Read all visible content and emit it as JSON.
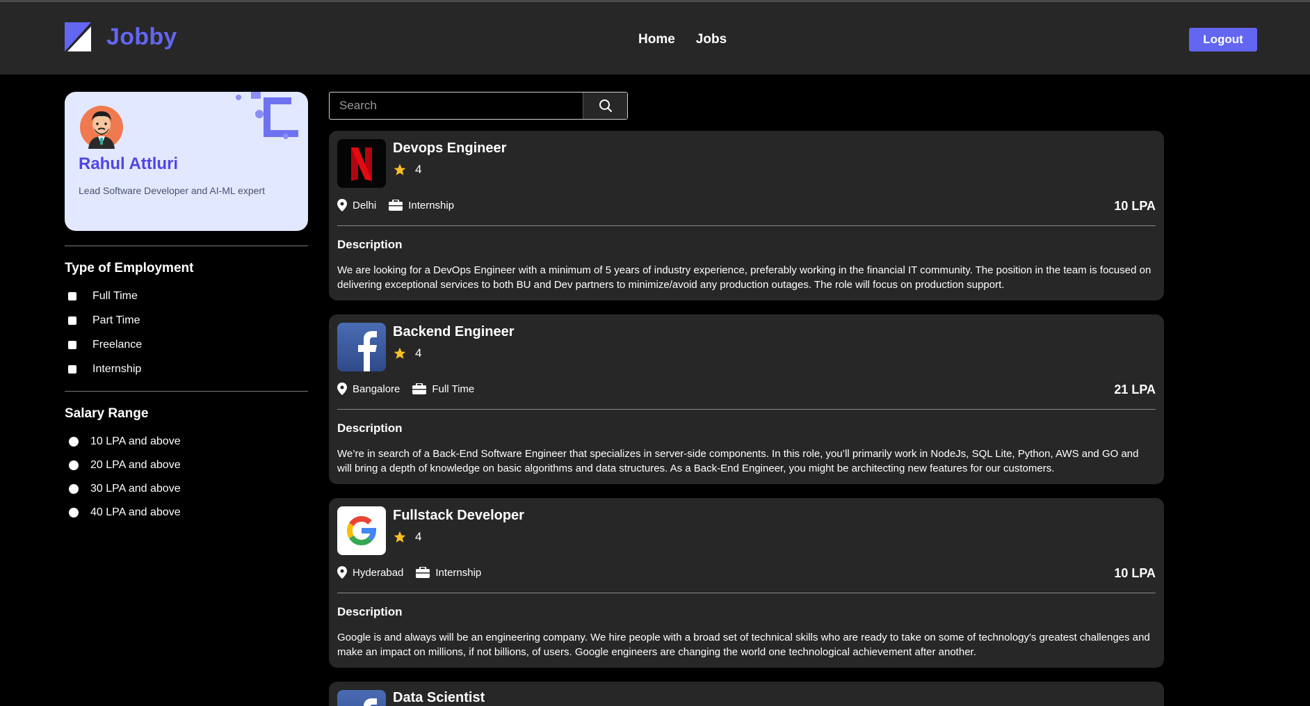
{
  "brand": {
    "name": "Jobby",
    "accent": "#6366f1"
  },
  "nav": {
    "home": "Home",
    "jobs": "Jobs",
    "logout": "Logout"
  },
  "profile": {
    "name": "Rahul Attluri",
    "bio": "Lead Software Developer and AI-ML expert"
  },
  "filters": {
    "employment_heading": "Type of Employment",
    "employment": [
      "Full Time",
      "Part Time",
      "Freelance",
      "Internship"
    ],
    "salary_heading": "Salary Range",
    "salary": [
      "10 LPA and above",
      "20 LPA and above",
      "30 LPA and above",
      "40 LPA and above"
    ]
  },
  "search": {
    "placeholder": "Search"
  },
  "jobs": [
    {
      "title": "Devops Engineer",
      "rating": "4",
      "location": "Delhi",
      "type": "Internship",
      "package": "10 LPA",
      "description_heading": "Description",
      "description": "We are looking for a DevOps Engineer with a minimum of 5 years of industry experience, preferably working in the financial IT community. The position in the team is focused on delivering exceptional services to both BU and Dev partners to minimize/avoid any production outages. The role will focus on production support.",
      "company_icon": "netflix-logo"
    },
    {
      "title": "Backend Engineer",
      "rating": "4",
      "location": "Bangalore",
      "type": "Full Time",
      "package": "21 LPA",
      "description_heading": "Description",
      "description": "We’re in search of a Back-End Software Engineer that specializes in server-side components. In this role, you’ll primarily work in NodeJs, SQL Lite, Python, AWS and GO and will bring a depth of knowledge on basic algorithms and data structures. As a Back-End Engineer, you might be architecting new features for our customers.",
      "company_icon": "facebook-logo"
    },
    {
      "title": "Fullstack Developer",
      "rating": "4",
      "location": "Hyderabad",
      "type": "Internship",
      "package": "10 LPA",
      "description_heading": "Description",
      "description": "Google is and always will be an engineering company. We hire people with a broad set of technical skills who are ready to take on some of technology's greatest challenges and make an impact on millions, if not billions, of users. Google engineers are changing the world one technological achievement after another.",
      "company_icon": "google-logo"
    },
    {
      "title": "Data Scientist",
      "company_icon": "facebook-logo"
    }
  ]
}
